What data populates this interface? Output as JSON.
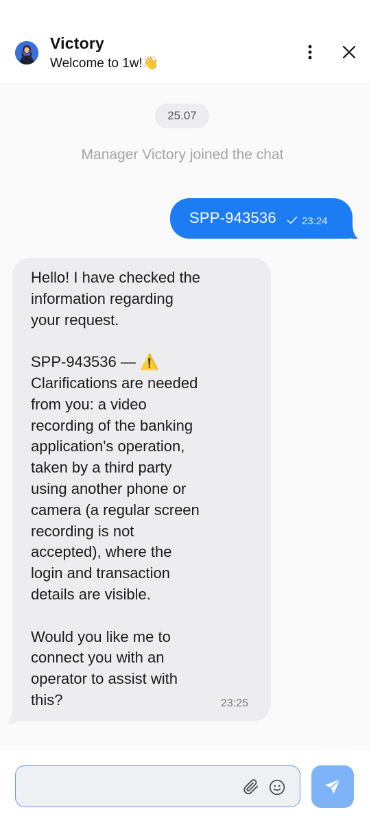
{
  "header": {
    "title": "Victory",
    "subtitle": "Welcome to 1w!👋",
    "avatar_icon": "agent-avatar",
    "menu_icon": "more-vertical-icon",
    "close_icon": "close-icon"
  },
  "chat": {
    "date": "25.07",
    "system_message": "Manager Victory joined the chat",
    "messages": [
      {
        "direction": "outgoing",
        "text": "SPP-943536",
        "time": "23:24",
        "status": "sent"
      },
      {
        "direction": "incoming",
        "text": "Hello! I have checked the\ninformation regarding\nyour request.\n\nSPP-943536 — ⚠️\nClarifications are needed\nfrom you: a video\nrecording of the banking\napplication's operation,\ntaken by a third party\nusing another phone or\ncamera (a regular screen\nrecording is not\naccepted), where the\nlogin and transaction\ndetails are visible.\n\nWould you like me to\nconnect you with an\noperator to assist with\nthis?",
        "time": "23:25"
      }
    ]
  },
  "composer": {
    "input_value": "",
    "placeholder": "",
    "attach_icon": "paperclip-icon",
    "emoji_icon": "emoji-icon",
    "send_icon": "send-icon"
  },
  "colors": {
    "outgoing_bubble": "#1c7cf4",
    "incoming_bubble": "#ededf0",
    "send_button": "#7eb4f7",
    "input_border": "#5b9bef"
  }
}
